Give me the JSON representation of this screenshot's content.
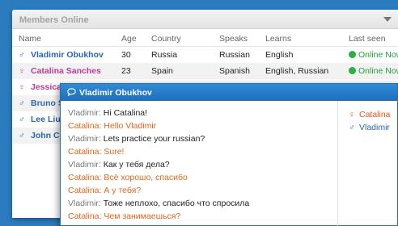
{
  "members": {
    "title": "Members Online",
    "columns": [
      "Name",
      "Age",
      "Country",
      "Speaks",
      "Learns",
      "Last seen"
    ],
    "rows": [
      {
        "gender": "♂",
        "name": "Vladimir Obukhov",
        "age": "30",
        "country": "Russia",
        "speaks": "Russian",
        "learns": "English",
        "status": "Online Now"
      },
      {
        "gender": "♀",
        "name": "Catalina Sanches",
        "age": "23",
        "country": "Spain",
        "speaks": "Spanish",
        "learns": "English, Russian",
        "status": "Online Now"
      },
      {
        "gender": "♀",
        "name": "Jessica"
      },
      {
        "gender": "♂",
        "name": "Bruno S"
      },
      {
        "gender": "♂",
        "name": "Lee Liu"
      },
      {
        "gender": "♂",
        "name": "John Co"
      }
    ]
  },
  "chat": {
    "title": "Vladimir Obukhov",
    "messages": [
      {
        "who": "Vladimir:",
        "text": "Hi Catalina!"
      },
      {
        "who": "Catalina:",
        "text": "Hello Vladimir"
      },
      {
        "who": "Vladimir:",
        "text": "Lets practice your russian?"
      },
      {
        "who": "Catalina:",
        "text": "Sure!"
      },
      {
        "who": "Vladimir:",
        "text": "Как у тебя дела?"
      },
      {
        "who": "Catalina:",
        "text": "Всё хорошо, спасибо"
      },
      {
        "who": "Catalina:",
        "text": "А у тебя?"
      },
      {
        "who": "Vladimir:",
        "text": "Тоже неплохо, спасибо что спросила"
      },
      {
        "who": "Catalina:",
        "text": "Чем занимаешься?"
      }
    ],
    "participants": [
      {
        "gender": "♀",
        "name": "Catalina"
      },
      {
        "gender": "♂",
        "name": "Vladimir"
      }
    ]
  },
  "colors": {
    "background": "#2b7bbf",
    "online": "#26b23c",
    "female": "#c0399a",
    "male": "#2a67b3",
    "catalina": "#e0661a"
  },
  "icons": {
    "collapse": "chevron-down-icon",
    "chat": "chat-bubble-icon",
    "female": "female-icon",
    "male": "male-icon",
    "online": "online-dot-icon"
  }
}
